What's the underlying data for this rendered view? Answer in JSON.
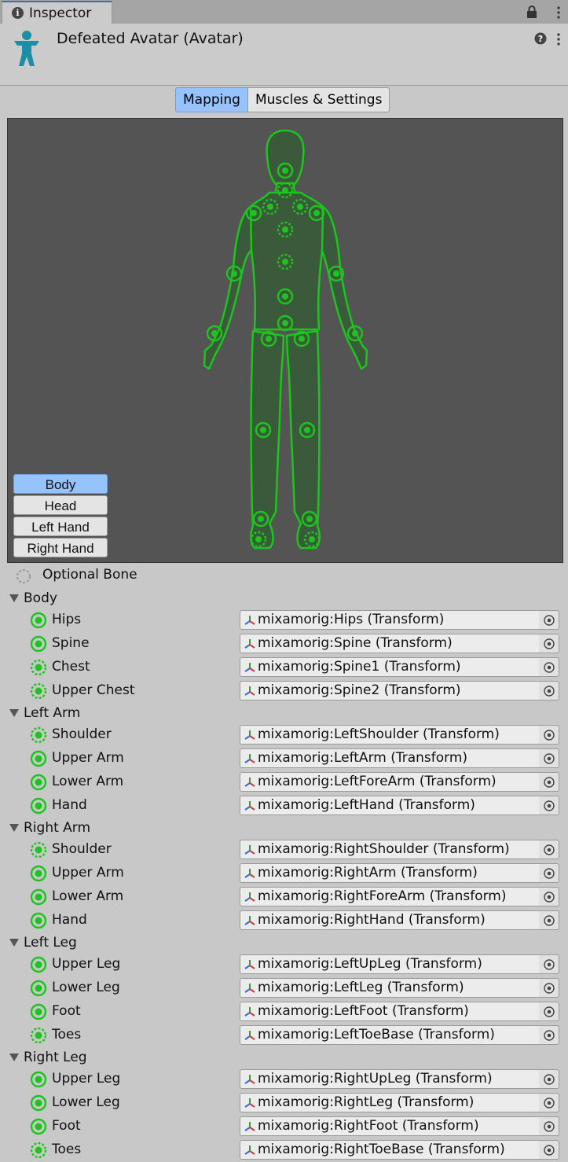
{
  "window": {
    "tab_label": "Inspector"
  },
  "header": {
    "title": "Defeated Avatar (Avatar)"
  },
  "toggle": {
    "mapping": "Mapping",
    "muscles": "Muscles & Settings"
  },
  "body_parts": {
    "body": "Body",
    "head": "Head",
    "left_hand": "Left Hand",
    "right_hand": "Right Hand"
  },
  "optional_bone_label": "Optional Bone",
  "colors": {
    "bone_green": "#1dc41d",
    "accent_blue": "#96c3fb",
    "viewport_bg": "#545454"
  },
  "groups": [
    {
      "name": "Body",
      "bones": [
        {
          "label": "Hips",
          "value": "mixamorig:Hips (Transform)",
          "optional": false
        },
        {
          "label": "Spine",
          "value": "mixamorig:Spine (Transform)",
          "optional": false
        },
        {
          "label": "Chest",
          "value": "mixamorig:Spine1 (Transform)",
          "optional": true
        },
        {
          "label": "Upper Chest",
          "value": "mixamorig:Spine2 (Transform)",
          "optional": true
        }
      ]
    },
    {
      "name": "Left Arm",
      "bones": [
        {
          "label": "Shoulder",
          "value": "mixamorig:LeftShoulder (Transform)",
          "optional": true
        },
        {
          "label": "Upper Arm",
          "value": "mixamorig:LeftArm (Transform)",
          "optional": false
        },
        {
          "label": "Lower Arm",
          "value": "mixamorig:LeftForeArm (Transform)",
          "optional": false
        },
        {
          "label": "Hand",
          "value": "mixamorig:LeftHand (Transform)",
          "optional": false
        }
      ]
    },
    {
      "name": "Right Arm",
      "bones": [
        {
          "label": "Shoulder",
          "value": "mixamorig:RightShoulder (Transform)",
          "optional": true
        },
        {
          "label": "Upper Arm",
          "value": "mixamorig:RightArm (Transform)",
          "optional": false
        },
        {
          "label": "Lower Arm",
          "value": "mixamorig:RightForeArm (Transform)",
          "optional": false
        },
        {
          "label": "Hand",
          "value": "mixamorig:RightHand (Transform)",
          "optional": false
        }
      ]
    },
    {
      "name": "Left Leg",
      "bones": [
        {
          "label": "Upper Leg",
          "value": "mixamorig:LeftUpLeg (Transform)",
          "optional": false
        },
        {
          "label": "Lower Leg",
          "value": "mixamorig:LeftLeg (Transform)",
          "optional": false
        },
        {
          "label": "Foot",
          "value": "mixamorig:LeftFoot (Transform)",
          "optional": false
        },
        {
          "label": "Toes",
          "value": "mixamorig:LeftToeBase (Transform)",
          "optional": true
        }
      ]
    },
    {
      "name": "Right Leg",
      "bones": [
        {
          "label": "Upper Leg",
          "value": "mixamorig:RightUpLeg (Transform)",
          "optional": false
        },
        {
          "label": "Lower Leg",
          "value": "mixamorig:RightLeg (Transform)",
          "optional": false
        },
        {
          "label": "Foot",
          "value": "mixamorig:RightFoot (Transform)",
          "optional": false
        },
        {
          "label": "Toes",
          "value": "mixamorig:RightToeBase (Transform)",
          "optional": true
        }
      ]
    }
  ]
}
